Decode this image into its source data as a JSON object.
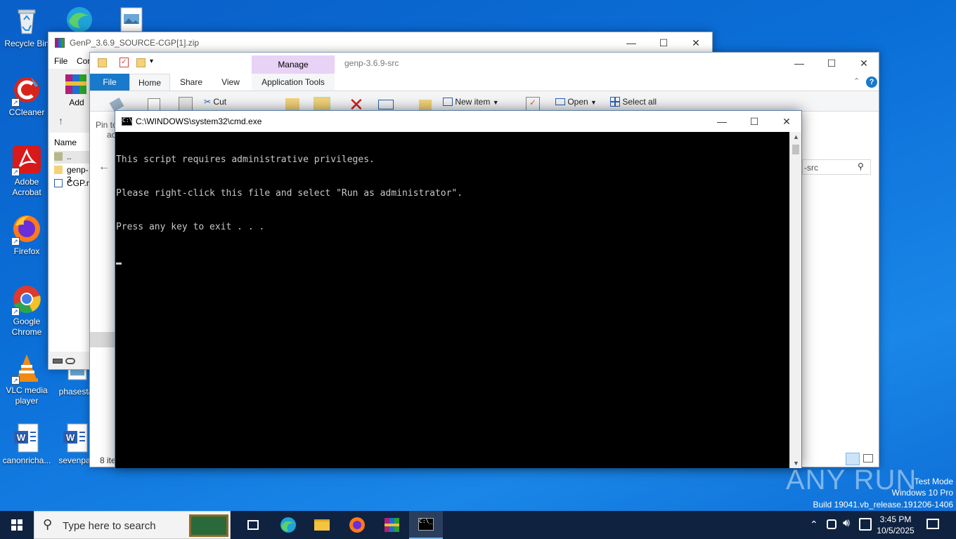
{
  "desktop": {
    "icons": [
      {
        "label": "Recycle Bin"
      },
      {
        "label": "CCleaner"
      },
      {
        "label": "Adobe Acrobat"
      },
      {
        "label": "Firefox"
      },
      {
        "label": "Google Chrome"
      },
      {
        "label": "VLC media player"
      },
      {
        "label": "canonricha..."
      },
      {
        "label": "phasestar"
      },
      {
        "label": "sevenpar"
      }
    ]
  },
  "winrar": {
    "title": "GenP_3.6.9_SOURCE-CGP[1].zip",
    "menu": [
      "File",
      "Cor"
    ],
    "toolbar_add": "Add",
    "list_header": "Name",
    "rows": [
      "..",
      "genp-3",
      "CGP.nt"
    ]
  },
  "explorer": {
    "title": "genp-3.6.9-src",
    "context_tab": "Manage",
    "tabs": [
      "File",
      "Home",
      "Share",
      "View",
      "Application Tools"
    ],
    "ribbon": {
      "pin_label": "Pin to",
      "pin_label2": "ac",
      "cut": "Cut",
      "new_item": "New item",
      "open": "Open",
      "select_all": "Select all"
    },
    "search_partial": "-src",
    "status": "8 ite"
  },
  "cmd": {
    "title": "C:\\WINDOWS\\system32\\cmd.exe",
    "lines": [
      "This script requires administrative privileges.",
      "Please right-click this file and select \"Run as administrator\".",
      "Press any key to exit . . ."
    ]
  },
  "watermark": {
    "brand": "ANY RUN",
    "test_mode": "Test Mode",
    "edition": "Windows 10 Pro",
    "build": "Build 19041.vb_release.191206-1406"
  },
  "taskbar": {
    "search_placeholder": "Type here to search",
    "time": "3:45 PM",
    "date": "10/5/2025"
  }
}
